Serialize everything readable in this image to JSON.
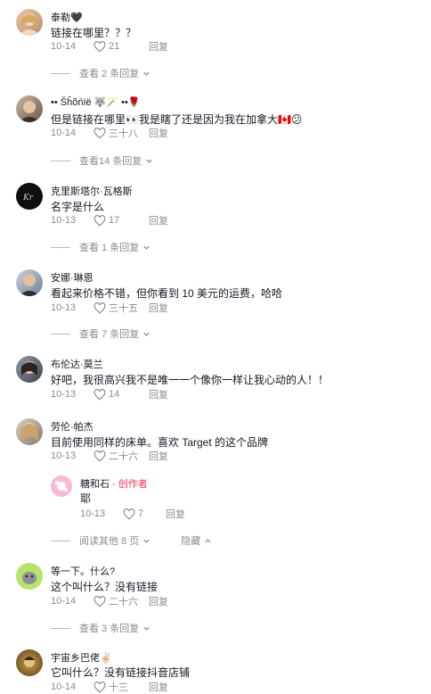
{
  "comments": [
    {
      "name": "泰勒🖤",
      "text": "链接在哪里？？？",
      "date": "10-14",
      "likes": "21",
      "reply": "回复",
      "view": "查看 2 条回复"
    },
    {
      "name": "•• Šĥõńïë 🐺🪄 ••🌹",
      "text": "但是链接在哪里👀我是瞎了还是因为我在加拿大🇨🇦😕",
      "date": "10-14",
      "likes": "三十八",
      "reply": "回复",
      "view": "查看14 条回复"
    },
    {
      "name": "克里斯塔尔·瓦格斯",
      "text": "名字是什么",
      "date": "10-13",
      "likes": "17",
      "reply": "回复",
      "view": "查看 1 条回复"
    },
    {
      "name": "安娜·琳恩",
      "text": "看起来价格不错，但你看到 10 美元的运费，哈哈",
      "date": "10-13",
      "likes": "三十五",
      "reply": "回复",
      "view": "查看 7 条回复"
    },
    {
      "name": "布伦达·莫兰",
      "text": "好吧，我很高兴我不是唯一一个像你一样让我心动的人！！",
      "date": "10-13",
      "likes": "14",
      "reply": "回复"
    },
    {
      "name": "劳伦·帕杰",
      "text": "目前使用同样的床单。喜欢 Target 的这个品牌",
      "date": "10-13",
      "likes": "二十六",
      "reply": "回复"
    },
    {
      "name": "等一下。什么?",
      "text": "这个叫什么？没有链接",
      "date": "10-14",
      "likes": "二十六",
      "reply": "回复",
      "view": "查看 3 条回复"
    },
    {
      "name": "宇宙乡巴佬✌🏻",
      "text": "它叫什么？没有链接抖音店铺",
      "date": "10-14",
      "likes": "十三",
      "reply": "回复"
    }
  ],
  "creator_reply": {
    "name": "糖和石",
    "separator": " · ",
    "badge": "创作者",
    "text": "耶",
    "date": "10-13",
    "likes": "7",
    "reply": "回复"
  },
  "thread_controls": {
    "view_more": "阅读其他 8 页",
    "hide": "隐藏"
  },
  "colors": {
    "accent": "#fe2c55",
    "muted": "#8a8b91"
  }
}
